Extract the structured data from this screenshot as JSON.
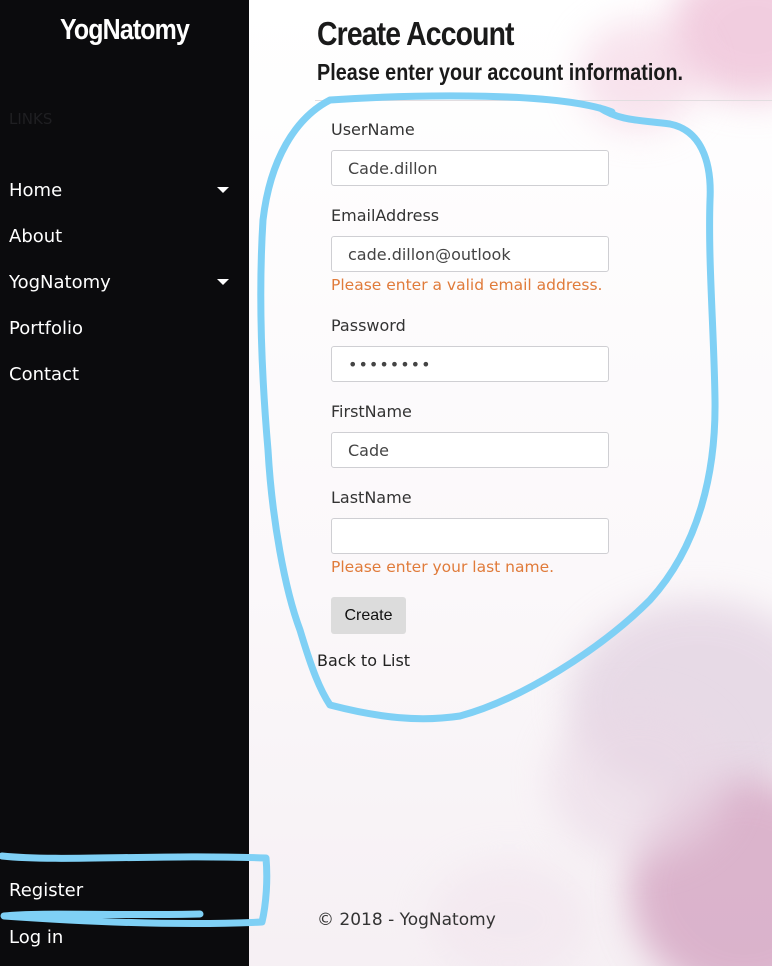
{
  "sidebar": {
    "brand": "YogNatomy",
    "links_label": "LINKS",
    "items": [
      {
        "label": "Home",
        "has_dropdown": true
      },
      {
        "label": "About",
        "has_dropdown": false
      },
      {
        "label": "YogNatomy",
        "has_dropdown": true
      },
      {
        "label": "Portfolio",
        "has_dropdown": false
      },
      {
        "label": "Contact",
        "has_dropdown": false
      }
    ],
    "register": "Register",
    "login": "Log in"
  },
  "main": {
    "title": "Create Account",
    "subtitle": "Please enter your account information.",
    "form": {
      "username": {
        "label": "UserName",
        "value": "Cade.dillon"
      },
      "email": {
        "label": "EmailAddress",
        "value": "cade.dillon@outlook",
        "error": "Please enter a valid email address."
      },
      "password": {
        "label": "Password",
        "value": "••••••••"
      },
      "firstname": {
        "label": "FirstName",
        "value": "Cade"
      },
      "lastname": {
        "label": "LastName",
        "value": "",
        "error": "Please enter your last name."
      },
      "create_label": "Create"
    },
    "back_link": "Back to List",
    "footer": "© 2018 - YogNatomy"
  },
  "colors": {
    "sidebar_bg": "#0b0b0d",
    "error": "#e07b3a",
    "annotation": "#7fd0f5"
  }
}
